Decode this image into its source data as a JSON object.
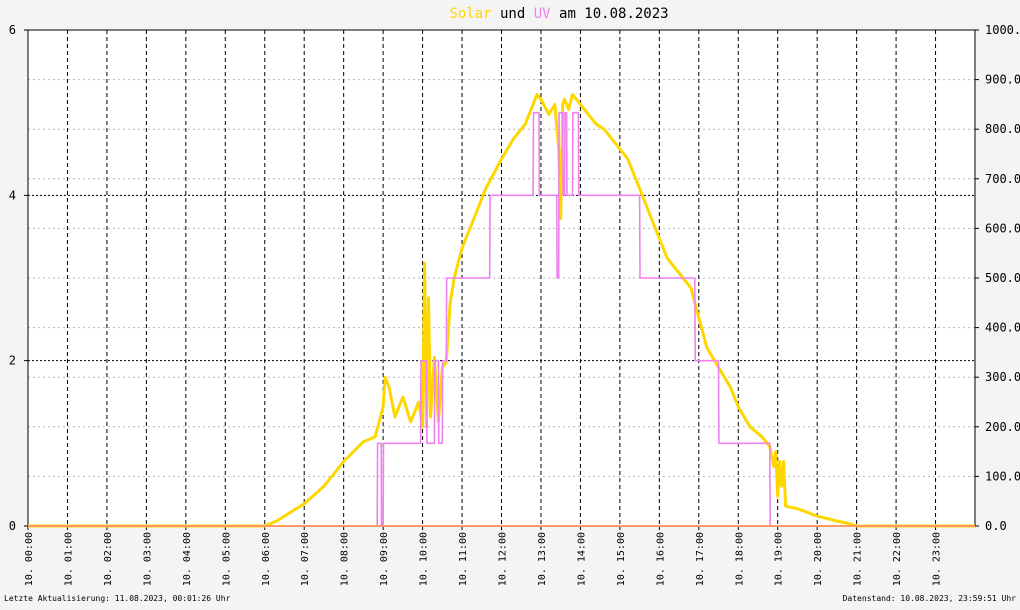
{
  "title": {
    "part1": "Solar",
    "part2": " und ",
    "part3": "UV",
    "part4": " am 10.08.2023"
  },
  "footer": {
    "left": "Letzte Aktualisierung: 11.08.2023, 00:01:26 Uhr",
    "right": "Datenstand: 10.08.2023, 23:59:51 Uhr"
  },
  "colors": {
    "solar": "#ffd700",
    "uv": "#ee82ee",
    "zero_line": "#ff9966",
    "background": "#ffffff",
    "page": "#f4f4f4"
  },
  "chart_data": {
    "type": "line",
    "title": "Solar und UV am 10.08.2023",
    "x_unit": "hour of day",
    "xlim": [
      0,
      24
    ],
    "x_tick_labels": [
      "10. 00:00",
      "10. 01:00",
      "10. 02:00",
      "10. 03:00",
      "10. 04:00",
      "10. 05:00",
      "10. 06:00",
      "10. 07:00",
      "10. 08:00",
      "10. 09:00",
      "10. 10:00",
      "10. 11:00",
      "10. 12:00",
      "10. 13:00",
      "10. 14:00",
      "10. 15:00",
      "10. 16:00",
      "10. 17:00",
      "10. 18:00",
      "10. 19:00",
      "10. 20:00",
      "10. 21:00",
      "10. 22:00",
      "10. 23:00"
    ],
    "y_left": {
      "lim": [
        0,
        6
      ],
      "ticks": [
        "0",
        "2",
        "4",
        "6"
      ]
    },
    "y_right": {
      "lim": [
        0,
        1000
      ],
      "ticks": [
        "0.0",
        "100.0",
        "200.0",
        "300.0",
        "400.0",
        "500.0",
        "600.0",
        "700.0",
        "800.0",
        "900.0",
        "1000.0"
      ]
    },
    "grid": true,
    "series": [
      {
        "name": "Solar",
        "axis": "right",
        "x": [
          0,
          6.0,
          6.3,
          6.6,
          7.0,
          7.5,
          8.0,
          8.5,
          8.8,
          9.0,
          9.05,
          9.15,
          9.3,
          9.5,
          9.7,
          9.9,
          10.0,
          10.05,
          10.1,
          10.15,
          10.2,
          10.3,
          10.4,
          10.5,
          10.6,
          10.7,
          10.8,
          11.0,
          11.3,
          11.6,
          12.0,
          12.3,
          12.6,
          12.8,
          12.9,
          13.0,
          13.2,
          13.35,
          13.45,
          13.5,
          13.55,
          13.6,
          13.7,
          13.8,
          13.9,
          14.0,
          14.2,
          14.4,
          14.6,
          14.8,
          15.0,
          15.2,
          15.4,
          15.6,
          15.8,
          16.0,
          16.2,
          16.5,
          16.8,
          17.0,
          17.2,
          17.5,
          17.8,
          18.0,
          18.3,
          18.6,
          18.8,
          18.9,
          18.95,
          19.0,
          19.05,
          19.1,
          19.15,
          19.2,
          19.5,
          20.0,
          20.5,
          20.8,
          21.0,
          24.0
        ],
        "values": [
          0,
          0,
          10,
          25,
          45,
          80,
          130,
          170,
          180,
          240,
          300,
          280,
          220,
          260,
          210,
          250,
          200,
          530,
          200,
          460,
          220,
          340,
          210,
          320,
          330,
          450,
          500,
          560,
          620,
          680,
          740,
          780,
          810,
          850,
          870,
          860,
          830,
          850,
          760,
          620,
          850,
          860,
          840,
          870,
          860,
          850,
          830,
          810,
          800,
          780,
          760,
          740,
          700,
          660,
          620,
          580,
          540,
          510,
          480,
          420,
          360,
          320,
          280,
          240,
          200,
          180,
          160,
          120,
          150,
          60,
          130,
          80,
          130,
          40,
          35,
          20,
          10,
          5,
          0,
          0
        ]
      },
      {
        "name": "UV",
        "axis": "left",
        "x": [
          0,
          8.85,
          8.86,
          8.95,
          8.96,
          9.0,
          9.01,
          9.95,
          9.96,
          10.1,
          10.11,
          10.3,
          10.31,
          10.4,
          10.41,
          10.5,
          10.51,
          10.6,
          10.61,
          10.7,
          10.71,
          11.7,
          11.71,
          12.8,
          12.81,
          12.95,
          12.96,
          13.1,
          13.11,
          13.4,
          13.41,
          13.45,
          13.46,
          13.55,
          13.56,
          13.6,
          13.61,
          13.65,
          13.66,
          13.8,
          13.81,
          13.95,
          13.96,
          15.5,
          15.51,
          16.9,
          16.91,
          17.0,
          17.01,
          17.5,
          17.51,
          17.6,
          17.61,
          18.8,
          18.81,
          24.0
        ],
        "values": [
          0,
          0,
          1,
          1,
          0,
          0,
          1,
          1,
          2,
          2,
          1,
          1,
          2,
          2,
          1,
          1,
          2,
          2,
          3,
          3,
          3,
          3,
          4,
          4,
          5,
          5,
          4,
          4,
          4,
          4,
          3,
          3,
          5,
          5,
          4,
          4,
          5,
          5,
          4,
          4,
          5,
          5,
          4,
          4,
          3,
          3,
          2,
          2,
          2,
          2,
          1,
          1,
          1,
          1,
          0,
          0
        ]
      }
    ]
  }
}
